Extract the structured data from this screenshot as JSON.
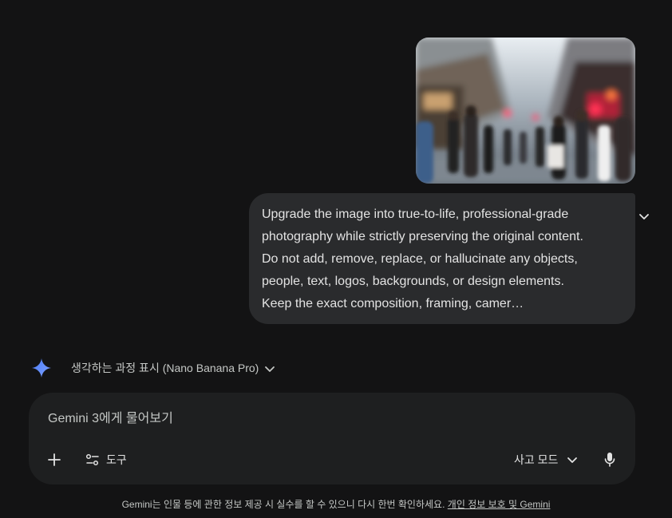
{
  "conversation": {
    "user_image_alt": "Blurred city street with pedestrians",
    "prompt": "Upgrade the image into true-to-life, professional-grade photography while strictly preserving the original content. Do not add, remove, replace, or hallucinate any objects, people, text, logos, backgrounds, or design elements. Keep the exact composition, framing, camer…",
    "expand_icon": "chevron-down-icon"
  },
  "thinking": {
    "label": "생각하는 과정 표시 (Nano Banana Pro)",
    "icon": "gemini-spark-icon",
    "accent": "#4a7bf7"
  },
  "composer": {
    "placeholder": "Gemini 3에게 물어보기",
    "tools_label": "도구",
    "mode_label": "사고 모드"
  },
  "footer": {
    "disclaimer": "Gemini는 인물 등에 관한 정보 제공 시 실수를 할 수 있으니 다시 한번 확인하세요.",
    "privacy_link": "개인 정보 보호 및 Gemini"
  },
  "colors": {
    "background": "#131314",
    "bubble": "#2a2b2d",
    "composer": "#1e1f20",
    "text": "#e3e3e3"
  }
}
